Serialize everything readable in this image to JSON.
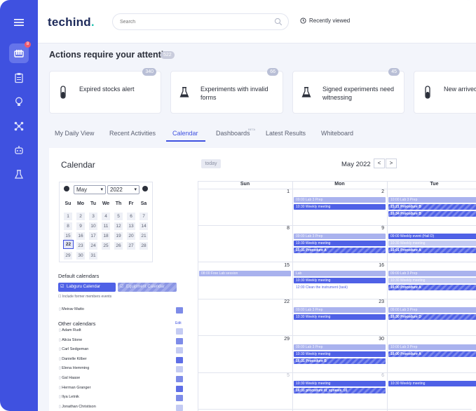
{
  "brand": {
    "name": "techind",
    "dot": "."
  },
  "sidebar": {
    "badge": "8",
    "items": [
      "menu-icon",
      "flask-rack-icon",
      "clipboard-icon",
      "bulb-icon",
      "molecule-icon",
      "robot-icon",
      "lab-icon"
    ]
  },
  "header": {
    "search_placeholder": "Search",
    "recently_viewed": "Recently viewed"
  },
  "attention": {
    "title": "Actions require your attention",
    "count": "522",
    "cards": [
      {
        "label": "Expired stocks alert",
        "count": "340",
        "icon": "tube-icon"
      },
      {
        "label": "Experiments with invalid forms",
        "count": "66",
        "icon": "flask-icon"
      },
      {
        "label": "Signed experiments need witnessing",
        "count": "45",
        "icon": "flask-icon"
      },
      {
        "label": "New arrived",
        "count": "",
        "icon": "tube-icon"
      }
    ]
  },
  "tabs": [
    {
      "label": "My Daily View"
    },
    {
      "label": "Recent Activities"
    },
    {
      "label": "Calendar"
    },
    {
      "label": "Dashboards",
      "tag": "BETA"
    },
    {
      "label": "Latest Results"
    },
    {
      "label": "Whiteboard"
    }
  ],
  "calendar_panel": {
    "heading": "Calendar",
    "mini": {
      "month": "May",
      "year": "2022",
      "dow": [
        "Su",
        "Mo",
        "Tu",
        "We",
        "Th",
        "Fr",
        "Sa"
      ],
      "weeks": [
        [
          "1",
          "2",
          "3",
          "4",
          "5",
          "6",
          "7"
        ],
        [
          "8",
          "9",
          "10",
          "11",
          "12",
          "13",
          "14"
        ],
        [
          "15",
          "16",
          "17",
          "18",
          "19",
          "20",
          "21"
        ],
        [
          "22",
          "23",
          "24",
          "25",
          "26",
          "27",
          "28"
        ],
        [
          "29",
          "30",
          "31",
          "",
          "",
          "",
          ""
        ]
      ],
      "today": "22"
    },
    "default_label": "Default calendars",
    "default_calendars": [
      "Labguru Calendar",
      "Equipment Calendar"
    ],
    "include_former": "Include former members events",
    "owner": "Meirav Matto",
    "other_label": "Other calendars",
    "edit": "Edit",
    "others": [
      "Adam Rudt",
      "Alicia Stone",
      "Carl Sedgeman",
      "Danielle Kilber",
      "Elena Hemming",
      "Gal Haase",
      "Herman Granger",
      "Ilya Letnik",
      "Jonathan Christison"
    ],
    "colors": {
      "accent": "#3f51e0",
      "event": "#4f61e6",
      "event_light": "#a9b2ee"
    }
  },
  "main_calendar": {
    "today_label": "today",
    "title": "May 2022",
    "prev": "<",
    "next": ">",
    "columns": [
      "Sun",
      "Mon",
      "Tue"
    ],
    "rows": [
      {
        "sun": "1",
        "mon": "2",
        "tue": "3"
      },
      {
        "sun": "8",
        "mon": "9",
        "tue": "10"
      },
      {
        "sun": "15",
        "mon": "16",
        "tue": "17"
      },
      {
        "sun": "22",
        "mon": "23",
        "tue": "24"
      },
      {
        "sun": "29",
        "mon": "30",
        "tue": "31"
      },
      {
        "sun": "5",
        "mon": "6",
        "tue": "7"
      }
    ],
    "events": {
      "r0_mon": [
        "09:00 Lab 3 Prep",
        "10:30 Weekly meeting"
      ],
      "r0_tue": [
        "10:00 Lab 3 Prep",
        "15:21 Procedure B",
        "16:34 Procedure B"
      ],
      "r1_mon": [
        "09:00 Lab 3 Prep",
        "10:30 Weekly meeting",
        "15:31 Procedure A"
      ],
      "r1_tue": [
        "09:00 Weekly event (Hall D)",
        "10:30 Weekly meeting",
        "16:01 Procedure A"
      ],
      "r2_sun": [
        "08:00 Free Lab session"
      ],
      "r2_mon": [
        "Lab",
        "10:30 Weekly meeting",
        "12:00 Clean the instrument (task)"
      ],
      "r2_tue": [
        "09:00 Lab 3 Prep",
        "10:30 Weekly meeting",
        "16:00 Procedure A"
      ],
      "r3_mon": [
        "09:00 Lab 3 Prep",
        "10:30 Weekly meeting"
      ],
      "r3_tue": [
        "09:00 Lab 3 Prep",
        "16:30 Procedure D"
      ],
      "r4_mon": [
        "09:00 Lab 3 Prep",
        "10:30 Weekly meeting",
        "16:31 Procedure B"
      ],
      "r4_tue": [
        "10:00 Lab 3 Prep",
        "16:00 Procedure A"
      ],
      "r5_mon": [
        "10:30 Weekly meeting",
        "16:31 procedure ill_synasis_01"
      ],
      "r5_tue": [
        "10:30 Weekly meeting"
      ]
    }
  }
}
